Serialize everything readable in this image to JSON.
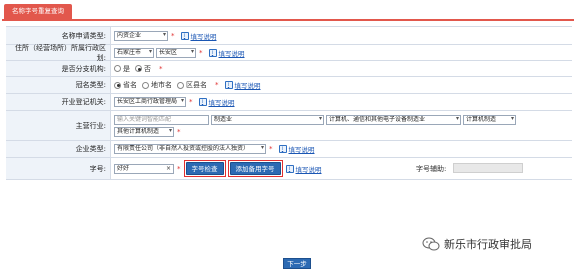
{
  "header": {
    "tab_label": "名称字号重复查询"
  },
  "rows": {
    "apply_type": {
      "label": "名称申请类型:",
      "value": "内资企业",
      "help": "填写说明"
    },
    "region": {
      "label": "住所（经营场所）所属行政区划:",
      "city": "石家庄市",
      "district": "长安区",
      "help": "填写说明"
    },
    "branch": {
      "label": "是否分支机构:",
      "options": [
        "是",
        "否"
      ],
      "selected": "否"
    },
    "prefix_type": {
      "label": "冠名类型:",
      "options": [
        "省名",
        "地市名",
        "区县名"
      ],
      "selected": "省名",
      "help": "填写说明"
    },
    "authority": {
      "label": "开业登记机关:",
      "value": "长安区工商行政管理局",
      "help": "填写说明"
    },
    "industry": {
      "label": "主营行业:",
      "placeholder": "输入关键词智能匹配",
      "level1": "制造业",
      "level2": "计算机、通信和其他电子设备制造业",
      "level3": "计算机制造",
      "level4": "其他计算机制造"
    },
    "org_form": {
      "label": "企业类型:",
      "value": "有限责任公司（非自然人投资或控股的法人独资）",
      "help": "填写说明"
    },
    "trade_name": {
      "label": "字号:",
      "value": "好好",
      "clear": "×",
      "check_button": "字号检查",
      "add_button": "添加备用字号",
      "help": "填写说明",
      "count_label": "字号辅助:"
    }
  },
  "footer": {
    "next_button": "下一步"
  },
  "watermark": {
    "text": "新乐市行政审批局"
  },
  "colors": {
    "accent": "#e2574c",
    "button": "#2c6ab3",
    "label_bg": "#eef3f9",
    "required": "#e03030"
  }
}
